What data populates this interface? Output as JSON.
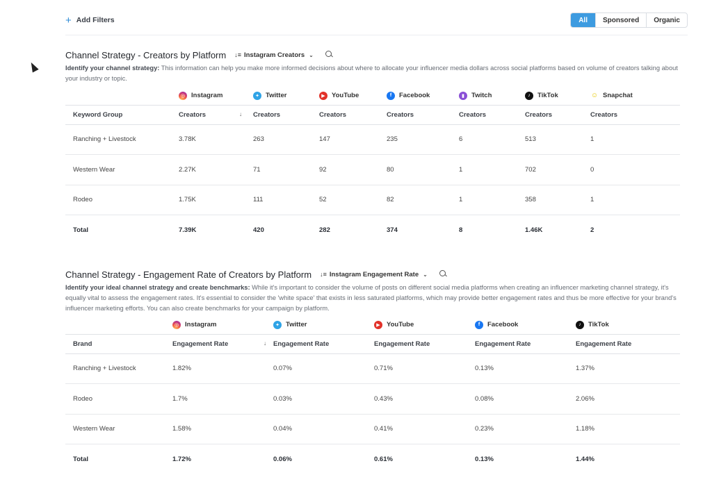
{
  "filters": {
    "add_label": "Add Filters",
    "segments": [
      "All",
      "Sponsored",
      "Organic"
    ],
    "active_segment": "All"
  },
  "section1": {
    "title": "Channel Strategy - Creators by Platform",
    "dropdown": "Instagram Creators",
    "desc_bold": "Identify your channel strategy:",
    "desc_text": " This information can help you make more informed decisions about where to allocate your influencer media dollars across social platforms based on volume of creators talking about your industry or topic.",
    "platforms": [
      "Instagram",
      "Twitter",
      "YouTube",
      "Facebook",
      "Twitch",
      "TikTok",
      "Snapchat"
    ],
    "first_col_header": "Keyword Group",
    "metric_header": "Creators",
    "rows": [
      {
        "name": "Ranching + Livestock",
        "values": [
          "3.78K",
          "263",
          "147",
          "235",
          "6",
          "513",
          "1"
        ]
      },
      {
        "name": "Western Wear",
        "values": [
          "2.27K",
          "71",
          "92",
          "80",
          "1",
          "702",
          "0"
        ]
      },
      {
        "name": "Rodeo",
        "values": [
          "1.75K",
          "111",
          "52",
          "82",
          "1",
          "358",
          "1"
        ]
      },
      {
        "name": "Total",
        "values": [
          "7.39K",
          "420",
          "282",
          "374",
          "8",
          "1.46K",
          "2"
        ]
      }
    ]
  },
  "section2": {
    "title": "Channel Strategy - Engagement Rate of Creators by Platform",
    "dropdown": "Instagram Engagement Rate",
    "desc_bold": "Identify your ideal channel strategy and create benchmarks:",
    "desc_text": " While it's important to consider the volume of posts on different social media platforms when creating an influencer marketing channel strategy, it's equally vital to assess the engagement rates. It's essential to consider the 'white space' that exists in less saturated platforms, which may provide better engagement rates and thus be more effective for your brand's influencer marketing efforts. You can also create benchmarks for your campaign by platform.",
    "platforms": [
      "Instagram",
      "Twitter",
      "YouTube",
      "Facebook",
      "TikTok"
    ],
    "first_col_header": "Brand",
    "metric_header": "Engagement Rate",
    "rows": [
      {
        "name": "Ranching + Livestock",
        "values": [
          "1.82%",
          "0.07%",
          "0.71%",
          "0.13%",
          "1.37%"
        ]
      },
      {
        "name": "Rodeo",
        "values": [
          "1.7%",
          "0.03%",
          "0.43%",
          "0.08%",
          "2.06%"
        ]
      },
      {
        "name": "Western Wear",
        "values": [
          "1.58%",
          "0.04%",
          "0.41%",
          "0.23%",
          "1.18%"
        ]
      },
      {
        "name": "Total",
        "values": [
          "1.72%",
          "0.06%",
          "0.61%",
          "0.13%",
          "1.44%"
        ]
      }
    ]
  },
  "icons": {
    "Instagram": "instagram-icon",
    "Twitter": "twitter-icon",
    "YouTube": "youtube-icon",
    "Facebook": "facebook-icon",
    "Twitch": "twitch-icon",
    "TikTok": "tiktok-icon",
    "Snapchat": "snapchat-icon"
  },
  "colors": {
    "accent": "#3d9be0"
  }
}
